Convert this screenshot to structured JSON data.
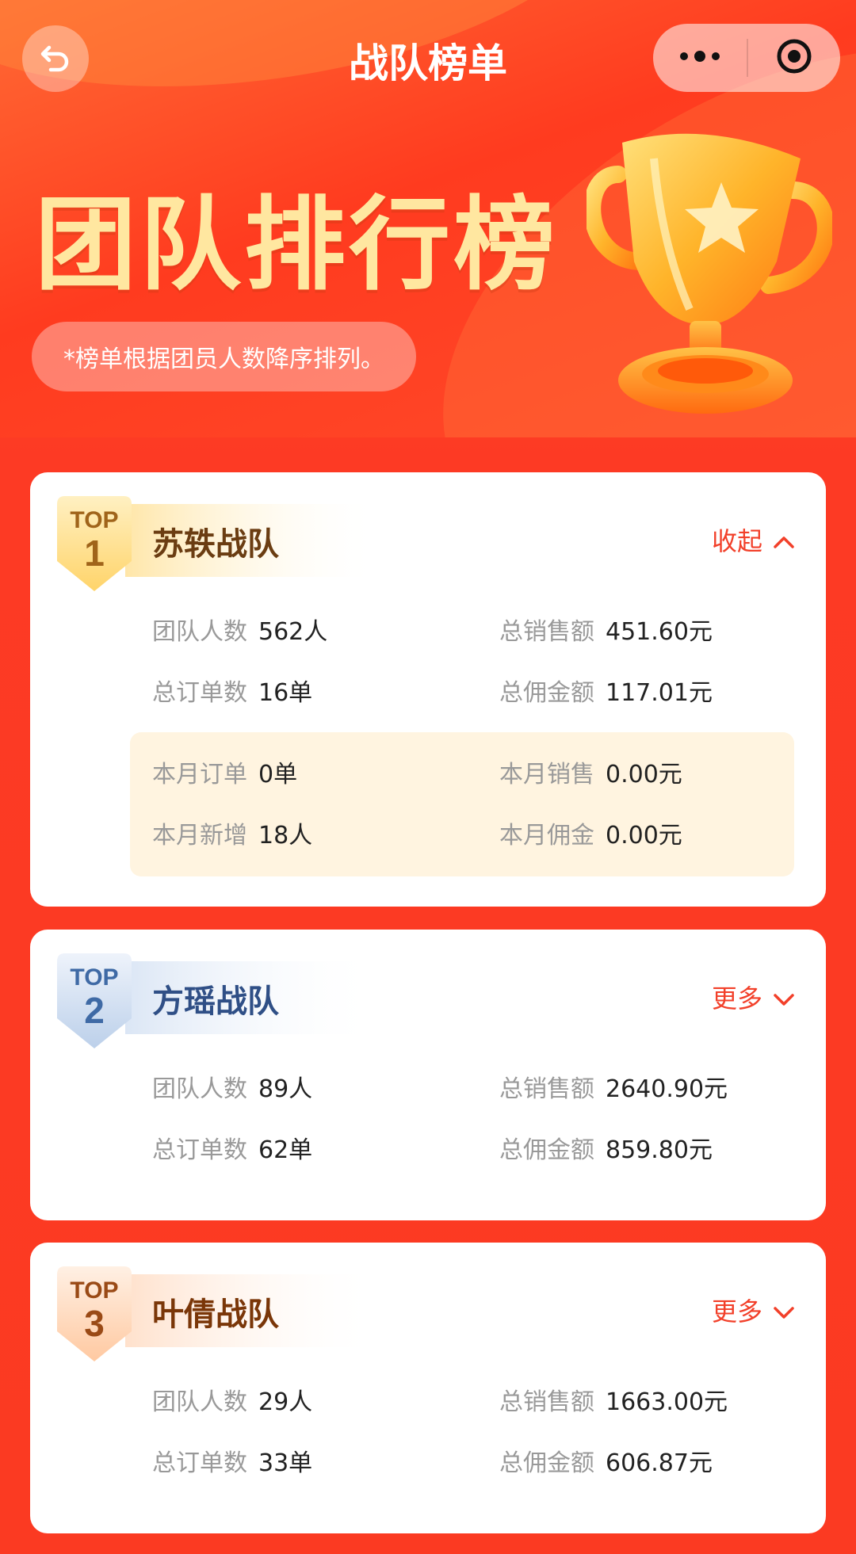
{
  "nav": {
    "title": "战队榜单"
  },
  "hero": {
    "title": "团队排行榜",
    "note": "*榜单根据团员人数降序排列。"
  },
  "icons": {
    "back": "back-arrow-icon",
    "more": "more-dots-icon",
    "close": "target-close-icon",
    "trophy": "trophy-icon"
  },
  "colors": {
    "accent": "#f2402a",
    "gold": "#ffe7a0",
    "bg": "#fb3a22"
  },
  "teams": [
    {
      "rank_label": "TOP",
      "rank": "1",
      "name": "苏轶战队",
      "toggle": "收起",
      "expanded": true,
      "stats": {
        "members_label": "团队人数",
        "members": "562人",
        "sales_label": "总销售额",
        "sales": "451.60元",
        "orders_label": "总订单数",
        "orders": "16单",
        "commission_label": "总佣金额",
        "commission": "117.01元"
      },
      "month": {
        "orders_label": "本月订单",
        "orders": "0单",
        "sales_label": "本月销售",
        "sales": "0.00元",
        "new_label": "本月新增",
        "new": "18人",
        "commission_label": "本月佣金",
        "commission": "0.00元"
      }
    },
    {
      "rank_label": "TOP",
      "rank": "2",
      "name": "方瑶战队",
      "toggle": "更多",
      "expanded": false,
      "stats": {
        "members_label": "团队人数",
        "members": "89人",
        "sales_label": "总销售额",
        "sales": "2640.90元",
        "orders_label": "总订单数",
        "orders": "62单",
        "commission_label": "总佣金额",
        "commission": "859.80元"
      }
    },
    {
      "rank_label": "TOP",
      "rank": "3",
      "name": "叶倩战队",
      "toggle": "更多",
      "expanded": false,
      "stats": {
        "members_label": "团队人数",
        "members": "29人",
        "sales_label": "总销售额",
        "sales": "1663.00元",
        "orders_label": "总订单数",
        "orders": "33单",
        "commission_label": "总佣金额",
        "commission": "606.87元"
      }
    }
  ]
}
